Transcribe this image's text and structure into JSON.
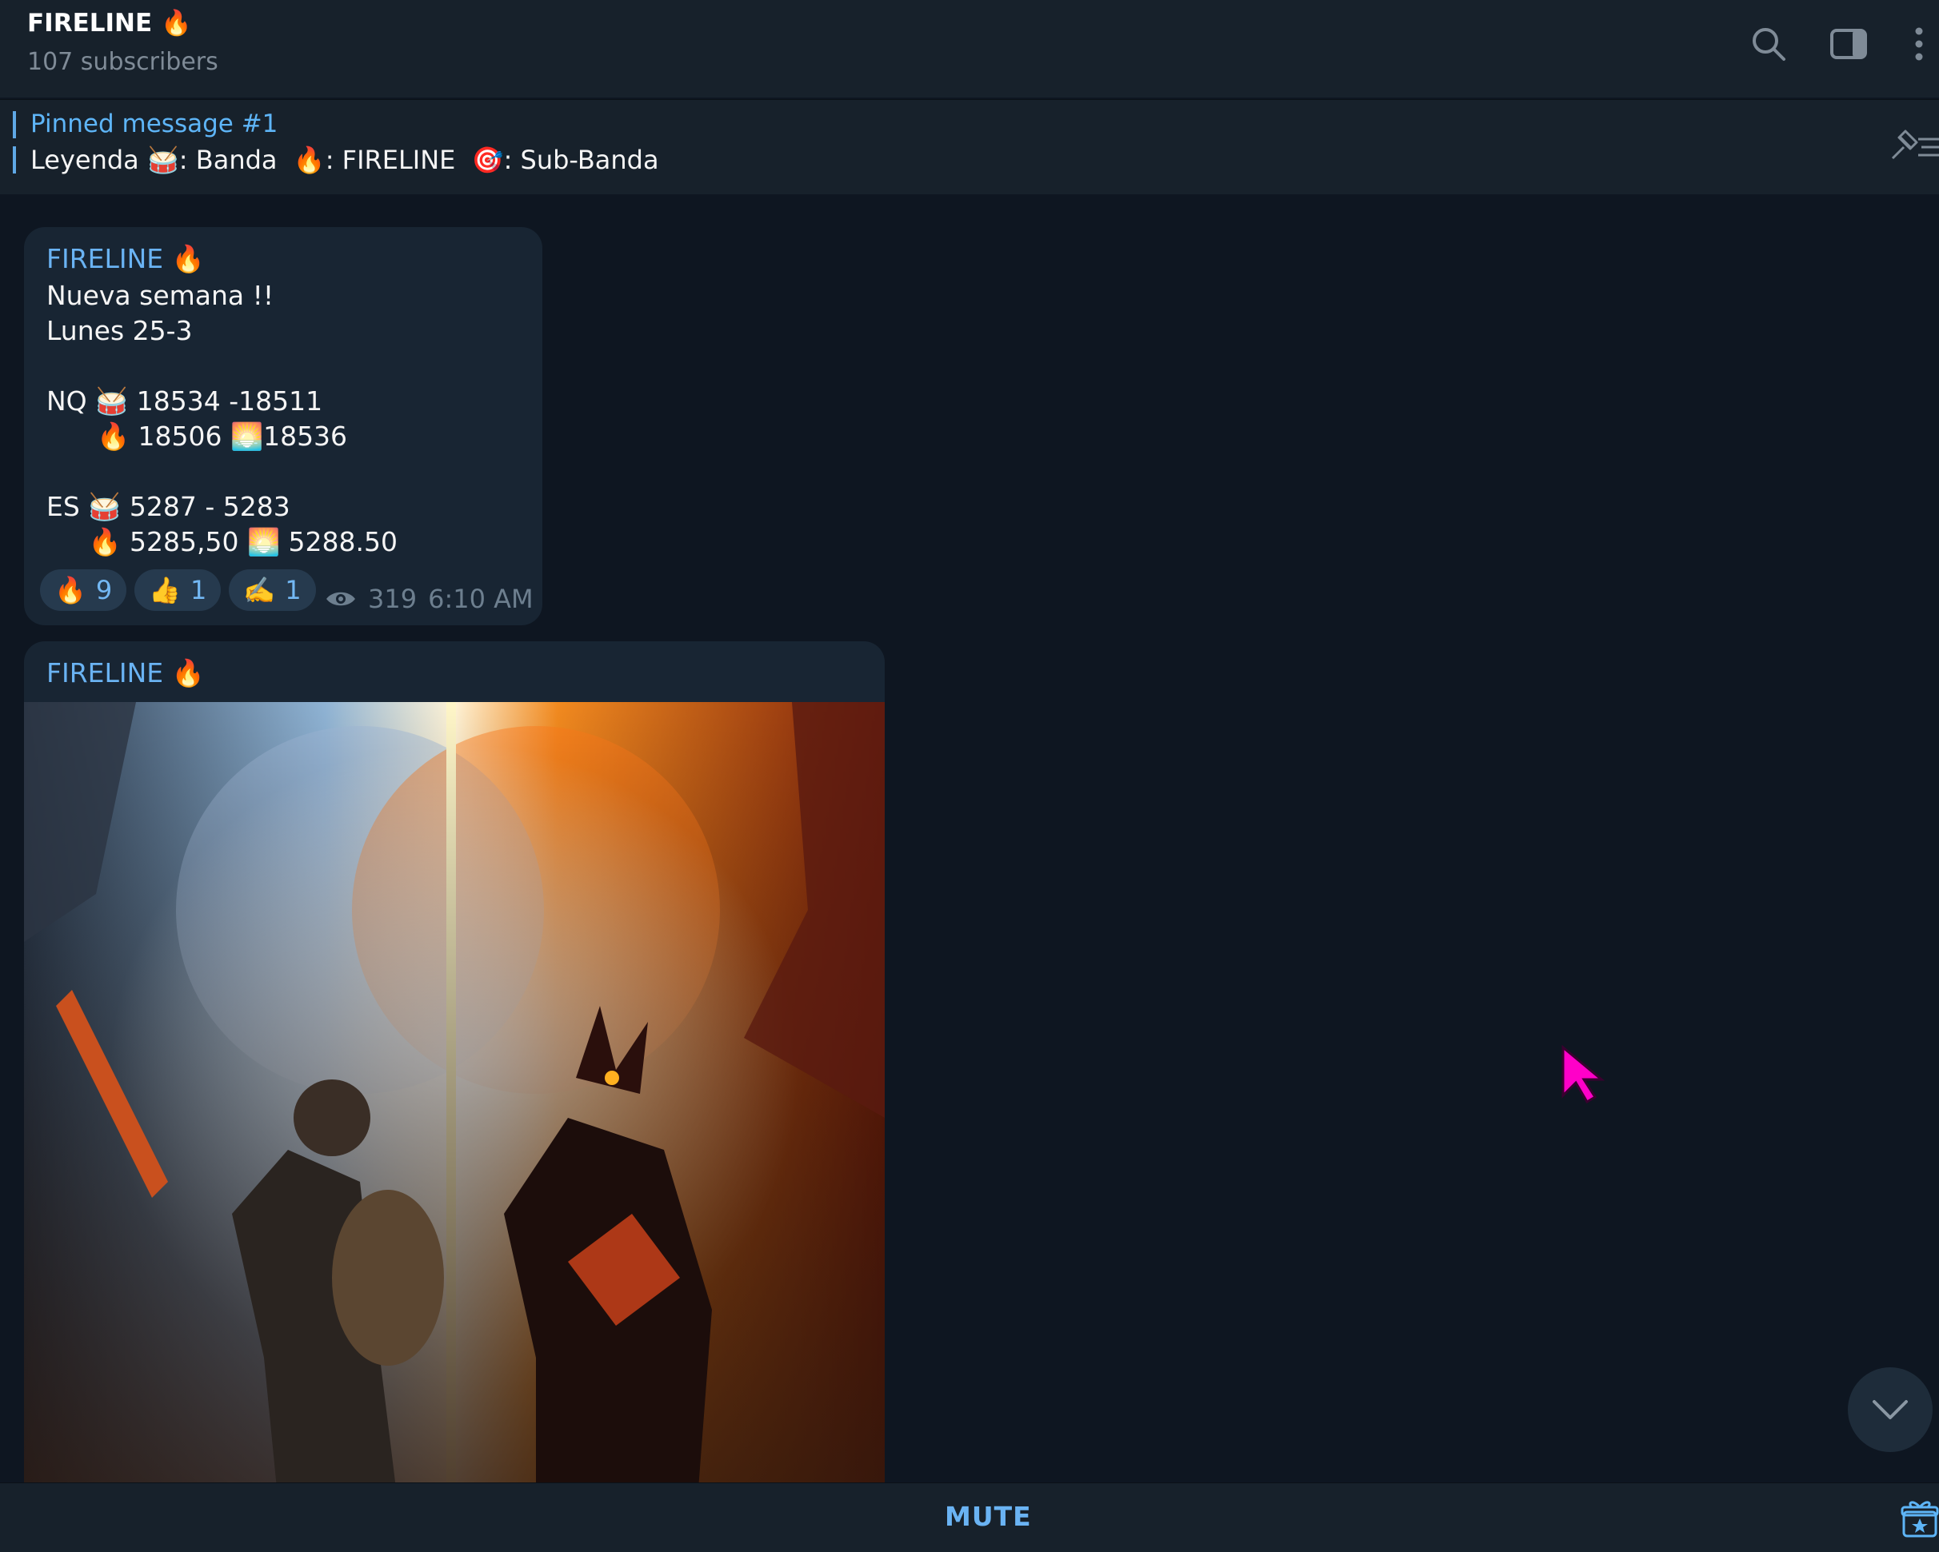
{
  "header": {
    "title": "FIRELINE 🔥",
    "subtitle": "107 subscribers"
  },
  "pinned": {
    "title": "Pinned message #1",
    "text": "Leyenda 🥁: Banda  🔥: FIRELINE  🎯: Sub-Banda"
  },
  "messages": [
    {
      "sender": "FIRELINE 🔥",
      "text": "Nueva semana !!\nLunes 25-3\n\nNQ 🥁 18534 -18511\n      🔥 18506 🌅18536\n\nES 🥁 5287 - 5283\n     🔥 5285,50 🌅 5288.50",
      "reactions": [
        {
          "emoji": "🔥",
          "count": "9"
        },
        {
          "emoji": "👍",
          "count": "1"
        },
        {
          "emoji": "✍️",
          "count": "1"
        }
      ],
      "views": "319",
      "time": "6:10 AM"
    },
    {
      "sender": "FIRELINE 🔥",
      "image": "fantasy-battle-warrior-vs-demon"
    }
  ],
  "footer": {
    "mute_label": "MUTE"
  },
  "icons": {
    "search": "search-icon",
    "sidebar": "sidebar-toggle-icon",
    "more": "more-vertical-icon",
    "pinned_list": "pinned-list-icon",
    "scroll_down": "chevron-down-icon",
    "gift": "gift-icon",
    "views": "eye-icon"
  },
  "colors": {
    "background": "#0e1621",
    "panel": "#17212b",
    "bubble": "#182533",
    "accent": "#6ab3f3",
    "cursor": "#ff00c8"
  }
}
